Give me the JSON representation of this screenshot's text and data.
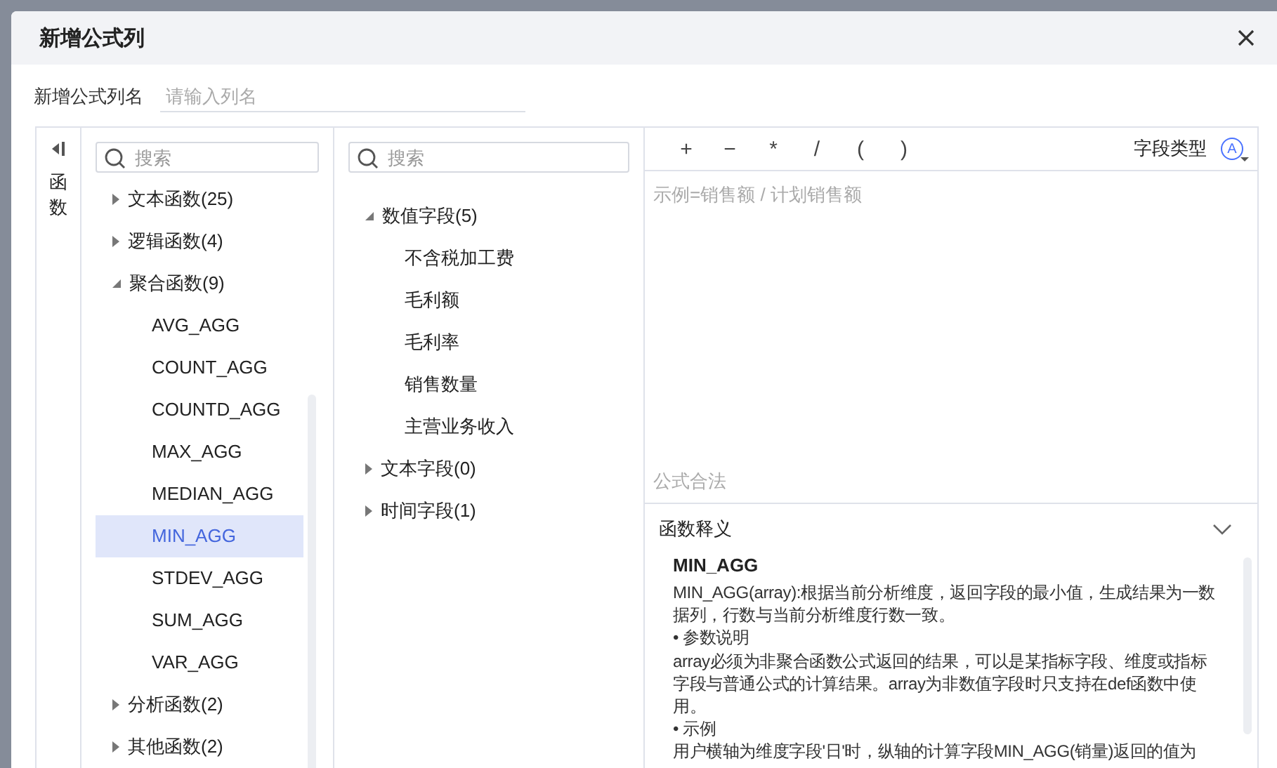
{
  "dialog": {
    "title": "新增公式列"
  },
  "name_field": {
    "label": "新增公式列名",
    "placeholder": "请输入列名"
  },
  "side_rail": {
    "label": "函数"
  },
  "function_panel": {
    "search": {
      "placeholder": "搜索"
    },
    "groups": [
      {
        "label": "文本函数(25)",
        "expanded": false
      },
      {
        "label": "逻辑函数(4)",
        "expanded": false
      },
      {
        "label": "聚合函数(9)",
        "expanded": true,
        "children": [
          {
            "label": "AVG_AGG",
            "selected": false
          },
          {
            "label": "COUNT_AGG",
            "selected": false
          },
          {
            "label": "COUNTD_AGG",
            "selected": false
          },
          {
            "label": "MAX_AGG",
            "selected": false
          },
          {
            "label": "MEDIAN_AGG",
            "selected": false
          },
          {
            "label": "MIN_AGG",
            "selected": true
          },
          {
            "label": "STDEV_AGG",
            "selected": false
          },
          {
            "label": "SUM_AGG",
            "selected": false
          },
          {
            "label": "VAR_AGG",
            "selected": false
          }
        ]
      },
      {
        "label": "分析函数(2)",
        "expanded": false
      },
      {
        "label": "其他函数(2)",
        "expanded": false
      }
    ]
  },
  "field_panel": {
    "search": {
      "placeholder": "搜索"
    },
    "groups": [
      {
        "label": "数值字段(5)",
        "expanded": true,
        "children": [
          {
            "label": "不含税加工费"
          },
          {
            "label": "毛利额"
          },
          {
            "label": "毛利率"
          },
          {
            "label": "销售数量"
          },
          {
            "label": "主营业务收入"
          }
        ]
      },
      {
        "label": "文本字段(0)",
        "expanded": false
      },
      {
        "label": "时间字段(1)",
        "expanded": false
      }
    ]
  },
  "editor": {
    "operators": [
      "+",
      "−",
      "*",
      "/",
      "(",
      ")"
    ],
    "field_type_label": "字段类型",
    "field_type_badge": "A",
    "placeholder": "示例=销售额 / 计划销售额",
    "status": "公式合法"
  },
  "help": {
    "title": "函数释义",
    "expanded": true,
    "function_name": "MIN_AGG",
    "paragraphs": [
      "MIN_AGG(array):根据当前分析维度，返回字段的最小值，生成结果为一数据列，行数与当前分析维度行数一致。",
      "•  参数说明",
      "array必须为非聚合函数公式返回的结果，可以是某指标字段、维度或指标字段与普通公式的计算结果。array为非数值字段时只支持在def函数中使用。",
      "•  示例",
      "用户横轴为维度字段'日'时，纵轴的计算字段MIN_AGG(销量)返回的值为"
    ]
  }
}
